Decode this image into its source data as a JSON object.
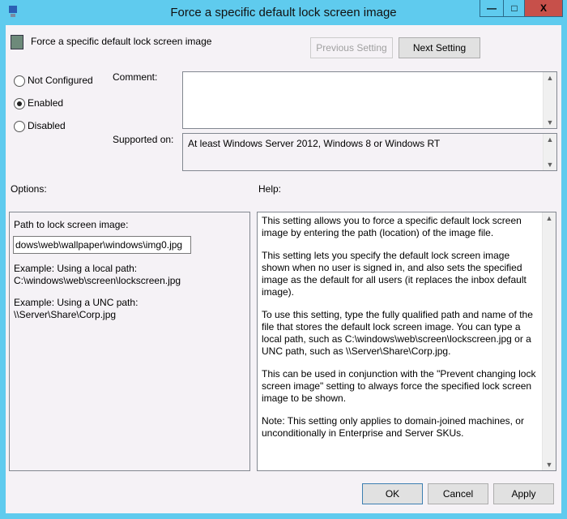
{
  "window": {
    "title": "Force a specific default lock screen image",
    "minimize": "—",
    "maximize": "□",
    "close": "X"
  },
  "header": {
    "policy_name": "Force a specific default lock screen image",
    "previous_label": "Previous Setting",
    "next_label": "Next Setting"
  },
  "state": {
    "options": [
      {
        "label": "Not Configured",
        "selected": false
      },
      {
        "label": "Enabled",
        "selected": true
      },
      {
        "label": "Disabled",
        "selected": false
      }
    ]
  },
  "comment": {
    "label": "Comment:",
    "value": ""
  },
  "supported": {
    "label": "Supported on:",
    "value": "At least Windows Server 2012, Windows 8 or Windows RT"
  },
  "options": {
    "label": "Options:",
    "path_label": "Path to lock screen image:",
    "path_value": "dows\\web\\wallpaper\\windows\\img0.jpg",
    "example_local_label": "Example: Using a local path:",
    "example_local_value": "C:\\windows\\web\\screen\\lockscreen.jpg",
    "example_unc_label": "Example: Using a UNC path:",
    "example_unc_value": "\\\\Server\\Share\\Corp.jpg"
  },
  "help": {
    "label": "Help:",
    "paragraphs": [
      "This setting allows you to force a specific default lock screen image by entering the path (location) of the image file.",
      "This setting lets you specify the default lock screen image shown when no user is signed in, and also sets the specified image as the default for all users (it replaces the inbox default image).",
      "To use this setting, type the fully qualified path and name of the file that stores the default lock screen image. You can type a local path, such as C:\\windows\\web\\screen\\lockscreen.jpg or a UNC path, such as \\\\Server\\Share\\Corp.jpg.",
      "This can be used in conjunction with the \"Prevent changing lock screen image\" setting to always force the specified lock screen image to be shown.",
      "Note: This setting only applies to domain-joined machines, or unconditionally in Enterprise and Server SKUs."
    ]
  },
  "footer": {
    "ok": "OK",
    "cancel": "Cancel",
    "apply": "Apply"
  }
}
